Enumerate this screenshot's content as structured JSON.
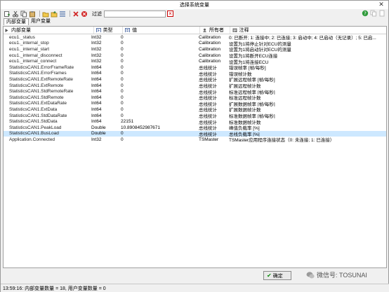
{
  "window": {
    "title": "选择系统变量"
  },
  "toolbar": {
    "filter_label": "过滤",
    "filter_value": ""
  },
  "tabs": [
    {
      "label": "内部变量"
    },
    {
      "label": "用户变量"
    }
  ],
  "columns": [
    "内部变量",
    "类型",
    "值",
    "所有者",
    "注释"
  ],
  "rows": [
    {
      "name": "ecu1._status",
      "type": "Int32",
      "value": "0",
      "owner": "Calibration",
      "comment": "0: 已断开; 1: 连接中; 2: 已连接; 3: 启动中; 4: 已启动（无记录）; 5: 已启..."
    },
    {
      "name": "ecu1._internal_stop",
      "type": "Int32",
      "value": "0",
      "owner": "Calibration",
      "comment": "设置为1将停止针对ECU的测量"
    },
    {
      "name": "ecu1._internal_start",
      "type": "Int32",
      "value": "0",
      "owner": "Calibration",
      "comment": "设置为1将启动针对ECU的测量"
    },
    {
      "name": "ecu1._internal_disconnect",
      "type": "Int32",
      "value": "0",
      "owner": "Calibration",
      "comment": "设置为1将断开ECU连接"
    },
    {
      "name": "ecu1._internal_connect",
      "type": "Int32",
      "value": "0",
      "owner": "Calibration",
      "comment": "设置为1将连接ECU"
    },
    {
      "name": "StatisticsCAN1.ErrorFrameRate",
      "type": "Int64",
      "value": "0",
      "owner": "总线统计",
      "comment": "错误帧率 [帧/每秒]"
    },
    {
      "name": "StatisticsCAN1.ErrorFrames",
      "type": "Int64",
      "value": "0",
      "owner": "总线统计",
      "comment": "错误帧计数"
    },
    {
      "name": "StatisticsCAN1.ExtRemoteRate",
      "type": "Int64",
      "value": "0",
      "owner": "总线统计",
      "comment": "扩展远程帧率 [帧/每秒]"
    },
    {
      "name": "StatisticsCAN1.ExtRemote",
      "type": "Int64",
      "value": "0",
      "owner": "总线统计",
      "comment": "扩展远程帧计数"
    },
    {
      "name": "StatisticsCAN1.StdRemoteRate",
      "type": "Int64",
      "value": "0",
      "owner": "总线统计",
      "comment": "标准远程帧率 [帧/每秒]"
    },
    {
      "name": "StatisticsCAN1.StdRemote",
      "type": "Int64",
      "value": "0",
      "owner": "总线统计",
      "comment": "标准远程帧计数"
    },
    {
      "name": "StatisticsCAN1.ExtDataRate",
      "type": "Int64",
      "value": "0",
      "owner": "总线统计",
      "comment": "扩展数据帧率 [帧/每秒]"
    },
    {
      "name": "StatisticsCAN1.ExtData",
      "type": "Int64",
      "value": "0",
      "owner": "总线统计",
      "comment": "扩展数据帧计数"
    },
    {
      "name": "StatisticsCAN1.StdDataRate",
      "type": "Int64",
      "value": "0",
      "owner": "总线统计",
      "comment": "标准数据帧率 [帧/每秒]"
    },
    {
      "name": "StatisticsCAN1.StdData",
      "type": "Int64",
      "value": "22151",
      "owner": "总线统计",
      "comment": "标准数据帧计数"
    },
    {
      "name": "StatisticsCAN1.PeakLoad",
      "type": "Double",
      "value": "10.8908452987671",
      "owner": "总线统计",
      "comment": "峰值负载率 [%]"
    },
    {
      "name": "StatisticsCAN1.BusLoad",
      "type": "Double",
      "value": "0",
      "owner": "总线统计",
      "comment": "总线负载率 [%]",
      "selected": true
    },
    {
      "name": "Application.Connected",
      "type": "Int32",
      "value": "0",
      "owner": "TSMaster",
      "comment": "TSMaster应用程序连接状态（0: 未连接; 1: 已连接）"
    }
  ],
  "footer": {
    "ok_label": "确定",
    "watermark": "微信号: TOSUNAI"
  },
  "status": {
    "text": "13:59:16: 内部变量数量 = 18, 用户变量数量 = 0"
  }
}
